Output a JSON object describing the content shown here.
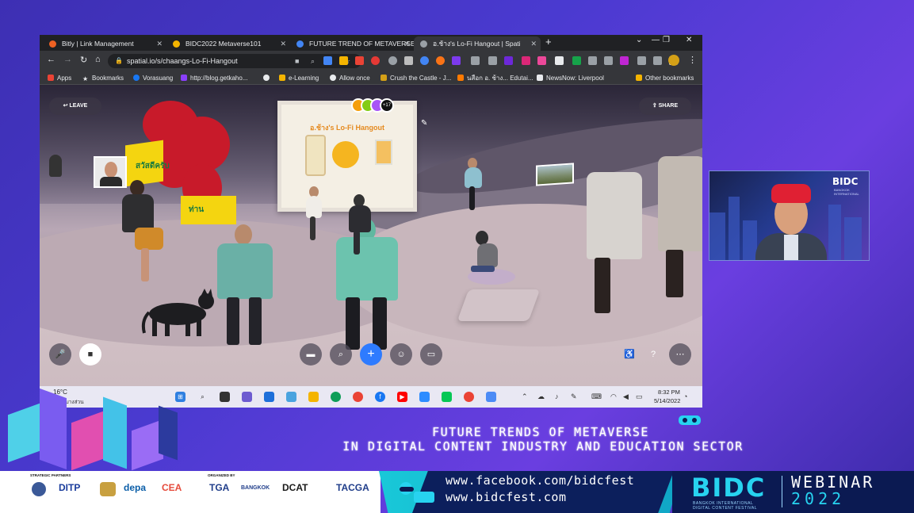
{
  "browser": {
    "tabs": [
      {
        "label": "Bitly | Link Management",
        "color": "#ee6123"
      },
      {
        "label": "BIDC2022 Metaverse101",
        "color": "#f4b400"
      },
      {
        "label": "FUTURE TREND OF METAVERSE I",
        "color": "#4285f4"
      },
      {
        "label": "อ.ช้าง's Lo-Fi Hangout | Spati",
        "color": "#9aa0a6"
      }
    ],
    "url": "spatial.io/s/chaangs-Lo-Fi-Hangout",
    "bookmarks": [
      {
        "label": "Apps",
        "color": "#ea4335"
      },
      {
        "label": "Bookmarks",
        "color": "#e8eaed"
      },
      {
        "label": "Vorasuang",
        "color": "#1877f2"
      },
      {
        "label": "http://blog.getkaho...",
        "color": "#8a3ffc"
      },
      {
        "label": "e-Learning",
        "color": "#f4b400"
      },
      {
        "label": "Allow once",
        "color": "#e8eaed"
      },
      {
        "label": "Crush the Castle - J...",
        "color": "#d4a017"
      },
      {
        "label": "นสือก อ. ช้าง... Edutai...",
        "color": "#ff7a00"
      },
      {
        "label": "NewsNow: Liverpool",
        "color": "#e8eaed"
      },
      {
        "label": "Other bookmarks",
        "color": "#f4b400"
      }
    ]
  },
  "scene": {
    "room_title": "อ.ช้าง's Lo-Fi Hangout",
    "leave_label": "LEAVE",
    "share_label": "SHARE",
    "participant_count": "+17",
    "poster_text_1": "สวัสดีครับ",
    "poster_text_2": "ท่าน"
  },
  "taskbar": {
    "temperature": "16°C",
    "weather": "มีเมฆบางส่วน",
    "time": "8:32 PM",
    "date": "5/14/2022"
  },
  "webcam": {
    "logo": "BIDC",
    "logo_sub": "BANGKOK INTERNATIONAL"
  },
  "event": {
    "headline_1": "FUTURE TRENDS OF METAVERSE",
    "headline_2": "IN DIGITAL CONTENT INDUSTRY AND EDUCATION SECTOR",
    "partners_label": "STRATEGIC PARTNERS",
    "organized_label": "ORGANIZED BY",
    "partners": [
      "DITP",
      "depa",
      "CEA"
    ],
    "organizers": [
      "TGA",
      "BANGKOK",
      "DCAT",
      "TACGA"
    ],
    "facebook": "www.facebook.com/bidcfest",
    "website": "www.bidcfest.com",
    "brand": "BIDC",
    "brand_sub_1": "BANGKOK INTERNATIONAL",
    "brand_sub_2": "DIGITAL CONTENT FESTIVAL",
    "webinar": "WEBINAR",
    "year": "2022"
  }
}
